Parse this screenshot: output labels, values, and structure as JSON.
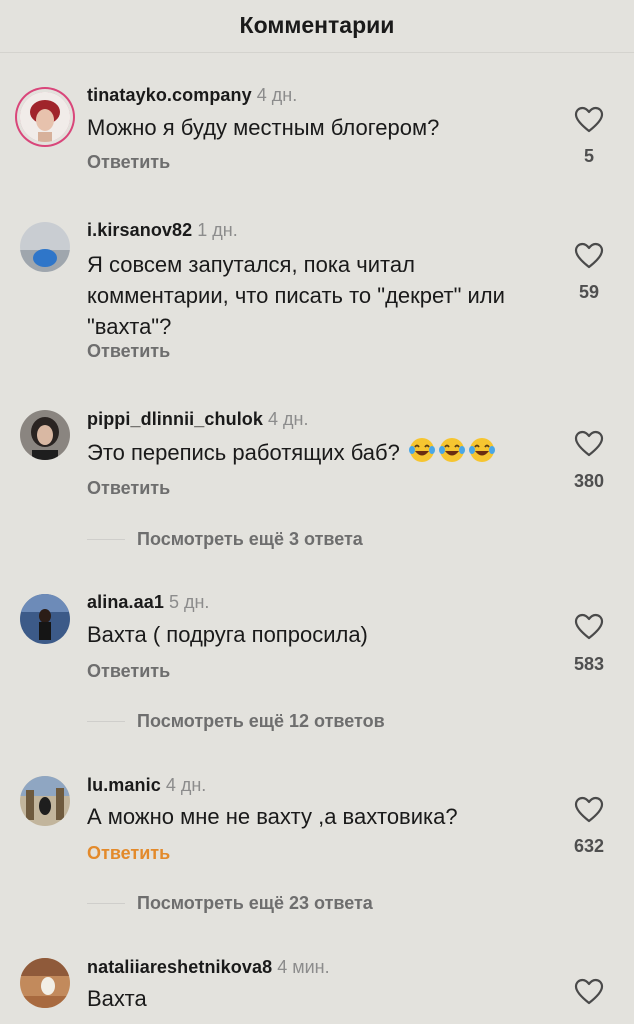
{
  "header": {
    "title": "Комментарии"
  },
  "reply_label": "Ответить",
  "comments": [
    {
      "username": "tinatayko.company",
      "age": "4 дн.",
      "text": "Можно я буду местным блогером?",
      "likes": "5"
    },
    {
      "username": "i.kirsanov82",
      "age": "1 дн.",
      "text": "Я совсем запутался, пока читал комментарии, что писать то \"декрет\" или \"вахта\"?",
      "likes": "59"
    },
    {
      "username": "pippi_dlinnii_chulok",
      "age": "4 дн.",
      "text": "Это перепись работящих баб?",
      "likes": "380",
      "more_replies": "Посмотреть ещё 3 ответа",
      "emojis": [
        "tears-of-joy-emoji",
        "tears-of-joy-emoji",
        "tears-of-joy-emoji"
      ]
    },
    {
      "username": "alina.aa1",
      "age": "5 дн.",
      "text": "Вахта ( подруга попросила)",
      "likes": "583",
      "more_replies": "Посмотреть ещё 12 ответов"
    },
    {
      "username": "lu.manic",
      "age": "4 дн.",
      "text": "А можно мне не вахту ,а вахтовика?",
      "likes": "632",
      "more_replies": "Посмотреть ещё 23 ответа"
    },
    {
      "username": "nataliiareshetnikova8",
      "age": "4 мин.",
      "text": "Вахта"
    }
  ],
  "colors": {
    "background": "#e3e2dd",
    "active_reply": "#e38a2b",
    "story_ring": "#d9467a"
  }
}
